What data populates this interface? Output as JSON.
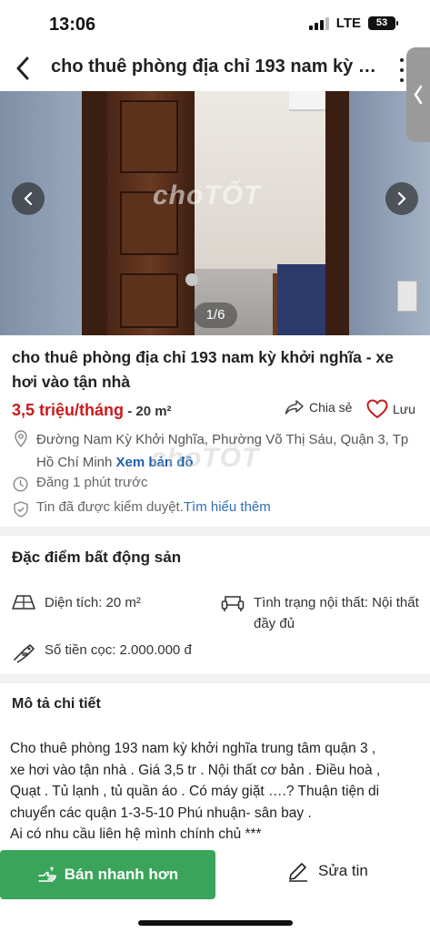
{
  "status_bar": {
    "time": "13:06",
    "network": "LTE",
    "battery": "53"
  },
  "header": {
    "title": "cho thuê phòng địa chỉ 193 nam kỳ khởi nghĩa - xe hơi vào tận nhà"
  },
  "gallery": {
    "counter": "1/6",
    "watermark": "choTỐT"
  },
  "listing": {
    "title": "cho thuê phòng địa chỉ 193 nam kỳ khởi nghĩa - xe hơi vào tận nhà",
    "price": "3,5 triệu/tháng",
    "area": " - 20 m²",
    "share_label": "Chia sẻ",
    "save_label": "Lưu",
    "address": "Đường Nam Kỳ Khởi Nghĩa, Phường Võ Thị Sáu, Quận 3, Tp Hồ Chí Minh",
    "map_link": "Xem bản đồ",
    "posted": "Đăng 1 phút trước",
    "verified": "Tin đã được kiểm duyệt.",
    "learn_more": "Tìm hiểu thêm",
    "watermark": "choTỐT"
  },
  "features": {
    "title": "Đặc điểm bất động sản",
    "area": "Diện tích: 20 m²",
    "furnishing": "Tình trạng nội thất: Nội thất đầy đủ",
    "deposit": "Số tiền cọc: 2.000.000 đ"
  },
  "description": {
    "title": "Mô tả chi tiết",
    "lines": [
      "Cho thuê phòng 193 nam kỳ khởi nghĩa trung tâm quận 3 ,",
      "xe hơi vào tận nhà . Giá 3,5 tr . Nội thất cơ bản . Điều hoà ,",
      "Quạt . Tủ lạnh , tủ quần áo . Có máy giặt ….? Thuận tiện di",
      "chuyển các quận 1-3-5-10 Phú nhuận- sân bay .",
      "Ai có nhu cầu liên hệ mình chính chủ ***"
    ]
  },
  "bottom_bar": {
    "sell_label": "Bán nhanh hơn",
    "edit_label": "Sửa tin"
  },
  "colors": {
    "price": "#c91a1a",
    "primary_button": "#3aa55a",
    "link": "#1f5fa8"
  }
}
